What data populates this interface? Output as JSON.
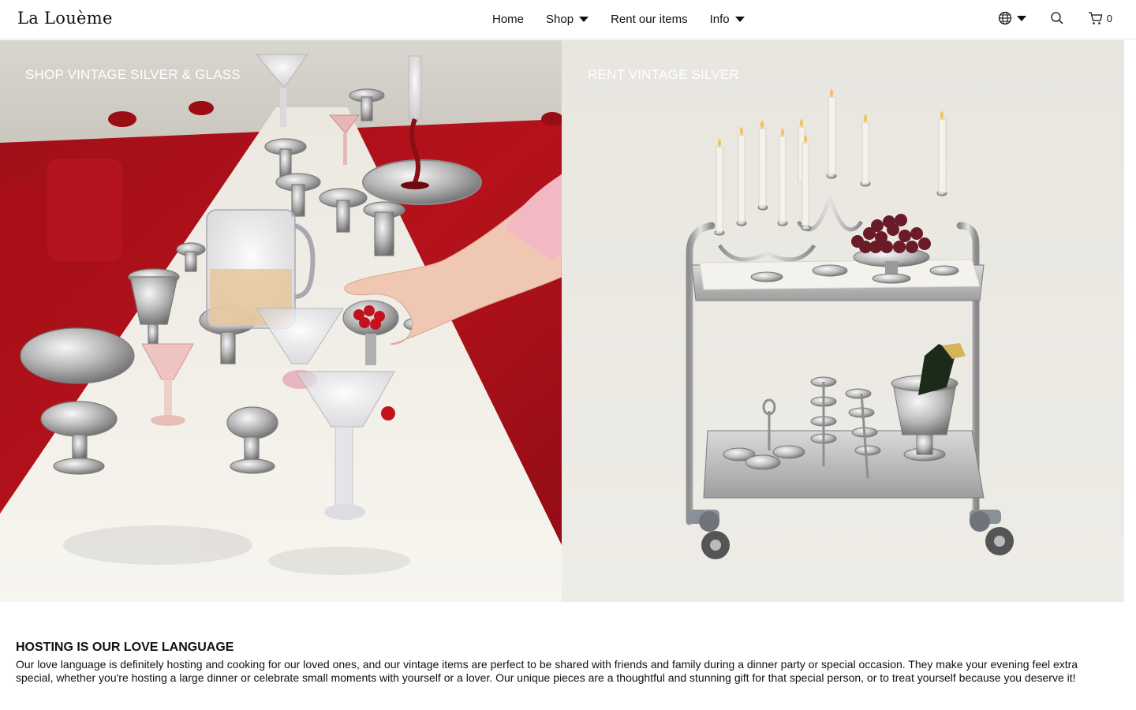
{
  "brand": {
    "logo": "La Louème"
  },
  "nav": {
    "home": "Home",
    "shop": "Shop",
    "rent": "Rent our items",
    "info": "Info"
  },
  "tools": {
    "language_icon": "globe-icon",
    "search_icon": "search-icon",
    "cart_icon": "cart-icon",
    "cart_count": "0"
  },
  "hero": {
    "left_label": "SHOP VINTAGE SILVER & GLASS",
    "right_label": "RENT VINTAGE SILVER"
  },
  "about": {
    "title": "HOSTING IS OUR LOVE LANGUAGE",
    "text": "Our love language is definitely hosting and cooking for our loved ones, and our vintage items are perfect to be shared with friends and family during a dinner party or special occasion. They make your evening feel extra special, whether you're hosting a large dinner or celebrate small moments with yourself or a lover. Our unique pieces are a thoughtful and stunning gift for that special person, or to treat yourself because you deserve it!"
  },
  "colors": {
    "table_red": "#b5121b",
    "runner_white": "#f2f0ea",
    "backdrop": "#e9e7e1",
    "silver": "#c8c8c8"
  }
}
